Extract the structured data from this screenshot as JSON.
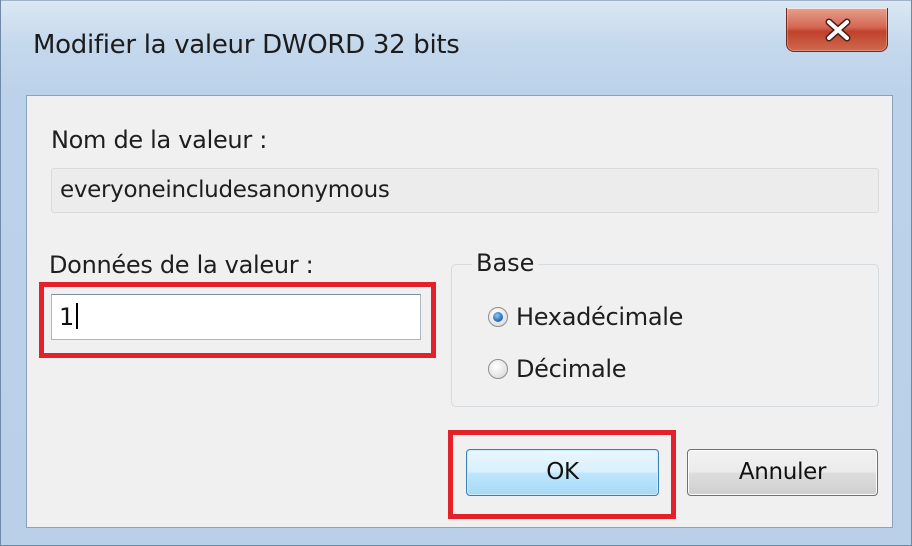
{
  "window": {
    "title": "Modifier la valeur DWORD 32 bits",
    "close_icon": "close-icon"
  },
  "form": {
    "name_label": "Nom de la valeur :",
    "name_value": "everyoneincludesanonymous",
    "data_label": "Données de la valeur :",
    "data_value": "1",
    "base": {
      "legend": "Base",
      "options": [
        {
          "label": "Hexadécimale",
          "checked": true
        },
        {
          "label": "Décimale",
          "checked": false
        }
      ]
    }
  },
  "buttons": {
    "ok_label": "OK",
    "cancel_label": "Annuler"
  },
  "highlights": {
    "color": "#e3212a"
  }
}
